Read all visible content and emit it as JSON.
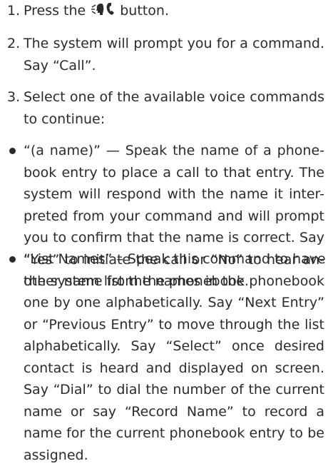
{
  "steps": [
    {
      "number": "1.",
      "before_icon": "Press the",
      "icon": "voice-phone-icon",
      "after_icon": "button."
    },
    {
      "number": "2.",
      "lines": [
        "The system will prompt you for a command.",
        "Say “Call”."
      ]
    },
    {
      "number": "3.",
      "lines": [
        "Select one of the available voice commands",
        "to continue:"
      ]
    }
  ],
  "bullets": [
    {
      "lines": [
        "“(a name)” — Speak the name of a phone-",
        "book entry to place a call to that entry. The",
        "system will respond with the name it inter-",
        "preted from your command and will prompt",
        "you to confirm that the name is correct. Say",
        "“Yes” to initiate the call or “No” to hear an-",
        "other name from the phonebook."
      ]
    },
    {
      "lines": [
        "“List Names” – Speak this command to have",
        "the system list the names in the phonebook",
        "one by one alphabetically. Say “Next Entry”",
        "or “Previous Entry” to move through the list",
        "alphabetically. Say “Select” once desired",
        "contact is heard and displayed on screen.",
        "Say “Dial” to dial the number of the current",
        "name or say “Record Name” to record a",
        "name for the current phonebook entry to be",
        "assigned."
      ]
    }
  ]
}
